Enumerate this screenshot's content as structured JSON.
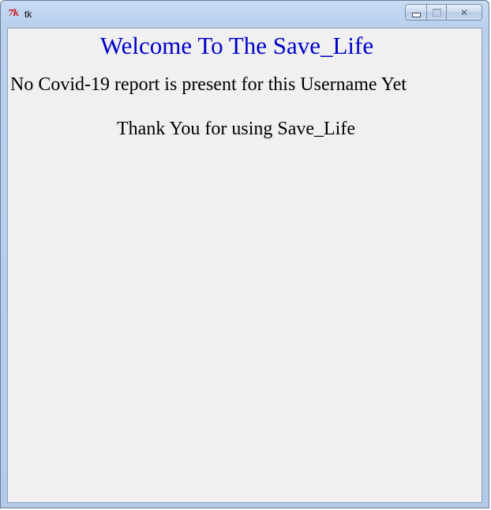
{
  "window": {
    "title": "tk",
    "icon": "tk-feather-icon",
    "controls": {
      "minimize": "minimize-icon",
      "maximize": "maximize-icon",
      "close": "close-icon"
    }
  },
  "content": {
    "welcome_text": "Welcome To The Save_Life",
    "report_text": "No Covid-19 report is present for this Username Yet",
    "thanks_text": "Thank You for using Save_Life"
  },
  "colors": {
    "welcome": "#0000cd",
    "body_text": "#000000",
    "background": "#f0f0f0"
  }
}
